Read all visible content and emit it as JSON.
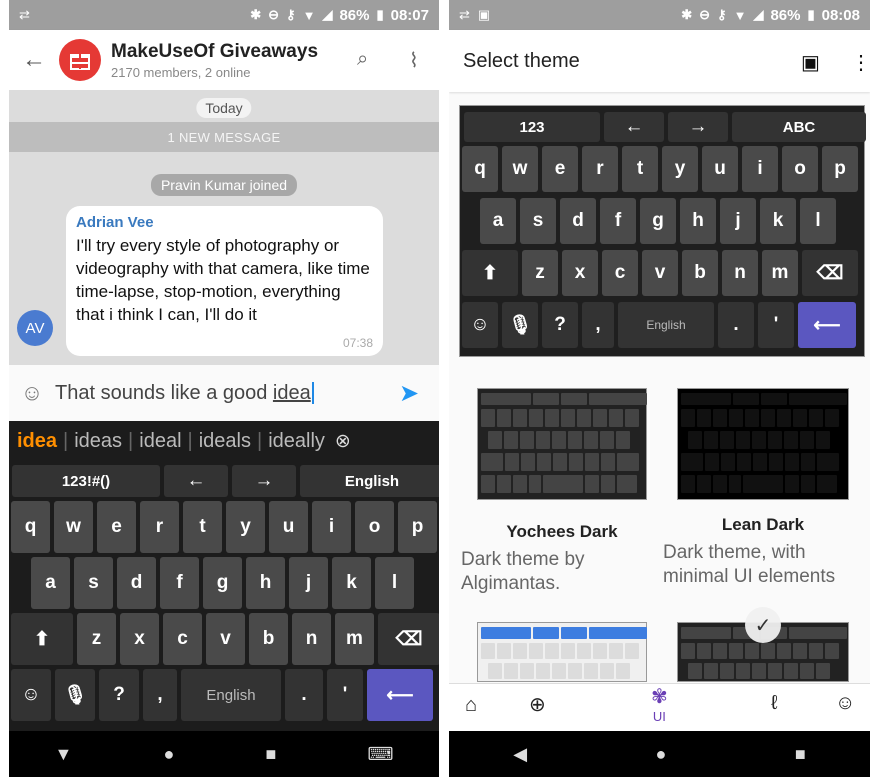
{
  "left": {
    "status": {
      "time": "08:07",
      "battery": "86%"
    },
    "header": {
      "title": "MakeUseOf Giveaways",
      "subtitle": "2170 members, 2 online"
    },
    "chat": {
      "date_pill": "Today",
      "new_messages": "1 NEW MESSAGE",
      "join_notice": "Pravin Kumar joined",
      "message": {
        "sender": "Adrian Vee",
        "text": "I'll try every style of photography or videography with that camera, like time time-lapse, stop-motion, everything that i think I can,  I'll do it",
        "time": "07:38",
        "avatar_initials": "AV"
      }
    },
    "compose": {
      "text_before": "That sounds like a good ",
      "current_word": "idea"
    },
    "keyboard": {
      "suggestions": [
        "idea",
        "ideas",
        "ideal",
        "ideals",
        "ideally"
      ],
      "row0": [
        "123!#()",
        "←",
        "→",
        "English"
      ],
      "row1": [
        "q",
        "w",
        "e",
        "r",
        "t",
        "y",
        "u",
        "i",
        "o",
        "p"
      ],
      "row2": [
        "a",
        "s",
        "d",
        "f",
        "g",
        "h",
        "j",
        "k",
        "l"
      ],
      "row3": [
        "z",
        "x",
        "c",
        "v",
        "b",
        "n",
        "m"
      ],
      "space_label": "English"
    }
  },
  "right": {
    "status": {
      "time": "08:08",
      "battery": "86%"
    },
    "header": {
      "title": "Select theme"
    },
    "preview": {
      "row0": [
        "123",
        "←",
        "→",
        "ABC"
      ],
      "row1": [
        "q",
        "w",
        "e",
        "r",
        "t",
        "y",
        "u",
        "i",
        "o",
        "p"
      ],
      "row2": [
        "a",
        "s",
        "d",
        "f",
        "g",
        "h",
        "j",
        "k",
        "l"
      ],
      "row3": [
        "z",
        "x",
        "c",
        "v",
        "b",
        "n",
        "m"
      ],
      "space_label": "English"
    },
    "themes": [
      {
        "name": "Yochees Dark",
        "desc_line1": "Dark theme by",
        "desc_line2": "Algimantas."
      },
      {
        "name": "Lean Dark",
        "desc_line1": "Dark theme, with",
        "desc_line2": "minimal UI elements"
      }
    ],
    "tabs": {
      "ui_label": "UI"
    }
  },
  "colors": {
    "accent_purple": "#5b57c0",
    "suggest_active": "#ff8f00",
    "send_blue": "#2196f3"
  }
}
